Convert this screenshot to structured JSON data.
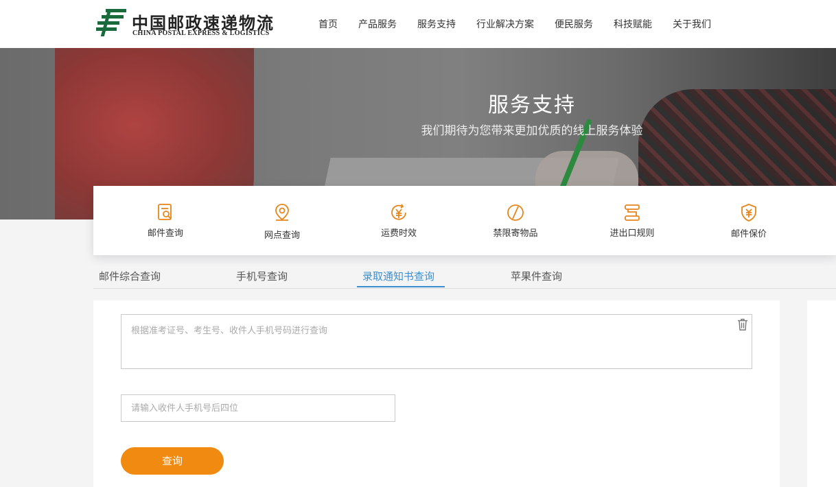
{
  "brand": {
    "name_cn": "中国邮政速递物流",
    "name_en": "CHINA POSTAL EXPRESS & LOGISTICS",
    "color": "#1a6b3c"
  },
  "nav": {
    "items": [
      "首页",
      "产品服务",
      "服务支持",
      "行业解决方案",
      "便民服务",
      "科技赋能",
      "关于我们"
    ]
  },
  "banner": {
    "title": "服务支持",
    "subtitle": "我们期待为您带来更加优质的线上服务体验"
  },
  "services": [
    {
      "label": "邮件查询",
      "icon": "mail-search-icon"
    },
    {
      "label": "网点查询",
      "icon": "location-pin-icon"
    },
    {
      "label": "运费时效",
      "icon": "yuan-clock-icon"
    },
    {
      "label": "禁限寄物品",
      "icon": "prohibited-icon"
    },
    {
      "label": "进出口规则",
      "icon": "import-export-icon"
    },
    {
      "label": "邮件保价",
      "icon": "yuan-shield-icon"
    }
  ],
  "tabs": {
    "items": [
      "邮件综合查询",
      "手机号查询",
      "录取通知书查询",
      "苹果件查询"
    ],
    "active": "录取通知书查询"
  },
  "form": {
    "query_placeholder": "根据准考证号、考生号、收件人手机号码进行查询",
    "phone_placeholder": "请输入收件人手机号后四位",
    "submit_label": "查询"
  },
  "colors": {
    "accent_orange": "#f08a10",
    "active_tab_blue": "#3a8fd0",
    "icon_orange": "#e8841a"
  }
}
